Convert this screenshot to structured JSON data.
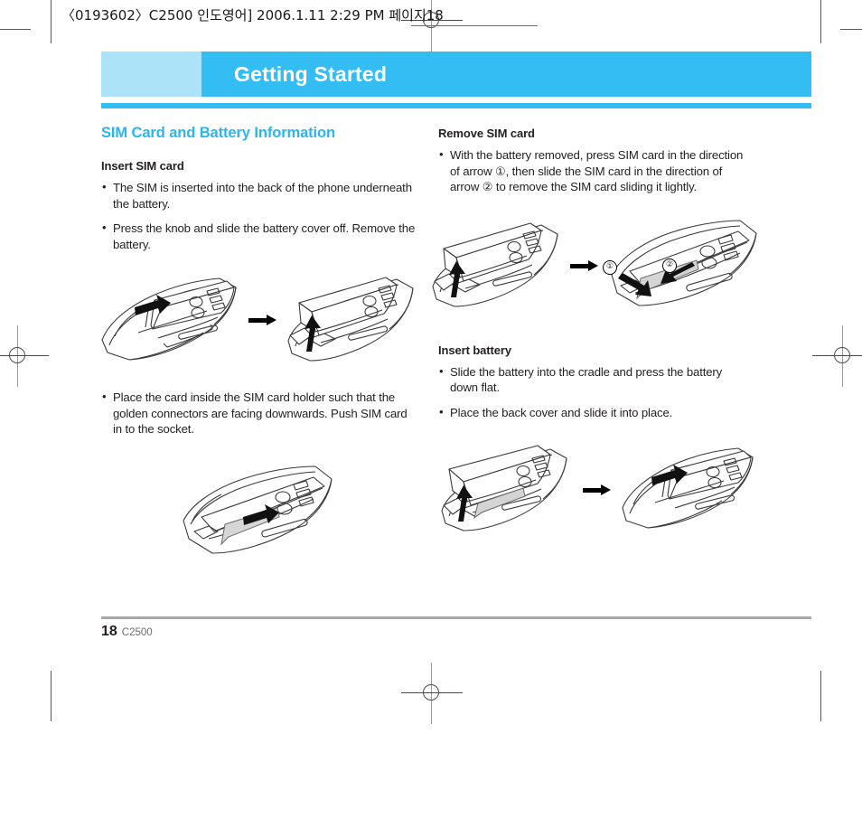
{
  "prepress": {
    "slug": "〈0193602〉C2500 인도영어]  2006.1.11 2:29 PM  페이지18"
  },
  "banner": {
    "title": "Getting Started",
    "left_color": "#ace3f9",
    "right_color": "#33bdf2"
  },
  "left_column": {
    "section_title": "SIM Card and Battery Information",
    "section_title_color": "#29b6ef",
    "subsections": [
      {
        "heading": "Insert SIM card",
        "bullets": [
          "The SIM is inserted into the back of the phone underneath the battery.",
          "Press the knob and slide the battery cover off. Remove the battery."
        ]
      },
      {
        "heading": "",
        "bullets": [
          "Place the card inside the SIM card holder such that the golden connectors are facing downwards. Push SIM card in to the socket."
        ]
      }
    ],
    "figures": [
      {
        "name": "insert-sim-figure-row",
        "items": [
          "phone-back-cover-arrow",
          "flow-arrow",
          "phone-battery-lift"
        ]
      },
      {
        "name": "sim-card-socket-figure",
        "items": [
          "phone-sim-push"
        ]
      }
    ]
  },
  "right_column": {
    "subsections": [
      {
        "heading": "Remove SIM card",
        "bullets": [
          "With the battery removed, press SIM card in the direction of arrow ①, then slide the SIM card in the direction of arrow ② to remove the SIM card sliding it lightly."
        ]
      },
      {
        "heading": "Insert battery",
        "bullets": [
          "Slide the battery into the cradle and press the battery down flat.",
          "Place the back cover and slide it into place."
        ]
      }
    ],
    "figures": [
      {
        "name": "remove-sim-figure-row",
        "items": [
          "phone-battery-lift",
          "flow-arrow",
          "phone-sim-remove"
        ],
        "callouts": [
          "①",
          "②"
        ]
      },
      {
        "name": "insert-battery-figure-row",
        "items": [
          "phone-battery-insert",
          "flow-arrow",
          "phone-cover-slide"
        ]
      }
    ]
  },
  "footer": {
    "page_number": "18",
    "model": "C2500"
  }
}
